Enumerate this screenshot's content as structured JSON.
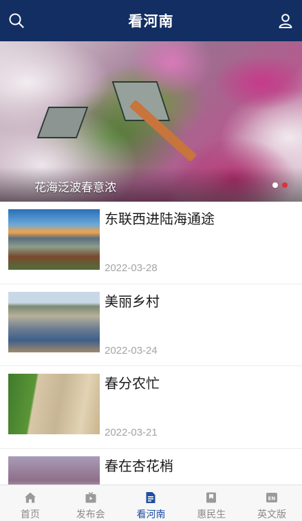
{
  "header": {
    "title": "看河南",
    "search_icon": "search-icon",
    "user_icon": "user-icon"
  },
  "banner": {
    "caption": "花海泛波春意浓",
    "dots": 2,
    "active_dot": 2,
    "active_dot_color": "#d8353a"
  },
  "articles": [
    {
      "title": "东联西进陆海通途",
      "date": "2022-03-28"
    },
    {
      "title": "美丽乡村",
      "date": "2022-03-24"
    },
    {
      "title": "春分农忙",
      "date": "2022-03-21"
    },
    {
      "title": "春在杏花梢",
      "date": ""
    }
  ],
  "tabs": [
    {
      "label": "首页",
      "icon": "home-icon",
      "active": false
    },
    {
      "label": "发布会",
      "icon": "press-conference-icon",
      "active": false
    },
    {
      "label": "看河南",
      "icon": "document-icon",
      "active": true
    },
    {
      "label": "惠民生",
      "icon": "bookmark-icon",
      "active": false
    },
    {
      "label": "英文版",
      "icon": "en-icon",
      "active": false
    }
  ],
  "colors": {
    "header_bg": "#122e63",
    "tab_active": "#1f4fa3",
    "tab_inactive": "#8a8a8a",
    "date": "#a3a3a3"
  }
}
